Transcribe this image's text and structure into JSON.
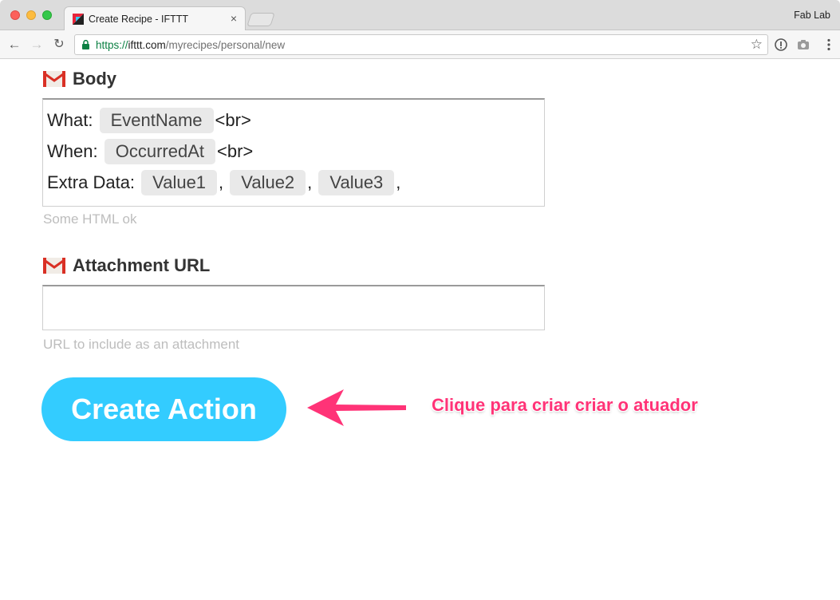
{
  "browser": {
    "tab_title": "Create Recipe - IFTTT",
    "tab_close": "×",
    "profile_name": "Fab Lab",
    "url": {
      "scheme": "https://",
      "host": "ifttt.com",
      "path": "/myrecipes/personal/new"
    }
  },
  "form": {
    "body": {
      "label": "Body",
      "lines": [
        {
          "prefix": "What:",
          "ingredient": "EventName",
          "suffix": "<br>"
        },
        {
          "prefix": "When:",
          "ingredient": "OccurredAt",
          "suffix": "<br>"
        },
        {
          "prefix": "Extra Data:",
          "ingredients": [
            "Value1",
            "Value2",
            "Value3"
          ],
          "separator": ",",
          "suffix": ","
        }
      ],
      "helper": "Some HTML ok"
    },
    "attachment": {
      "label": "Attachment URL",
      "value": "",
      "helper": "URL to include as an attachment"
    },
    "submit_label": "Create Action"
  },
  "annotation": {
    "text": "Clique para criar criar o atuador",
    "color": "#ff3377"
  },
  "colors": {
    "button": "#33ccff",
    "gmail_red": "#d93025"
  },
  "icons": [
    "gmail-icon",
    "lock-icon",
    "star-icon",
    "back-arrow-icon",
    "forward-arrow-icon",
    "reload-icon"
  ]
}
